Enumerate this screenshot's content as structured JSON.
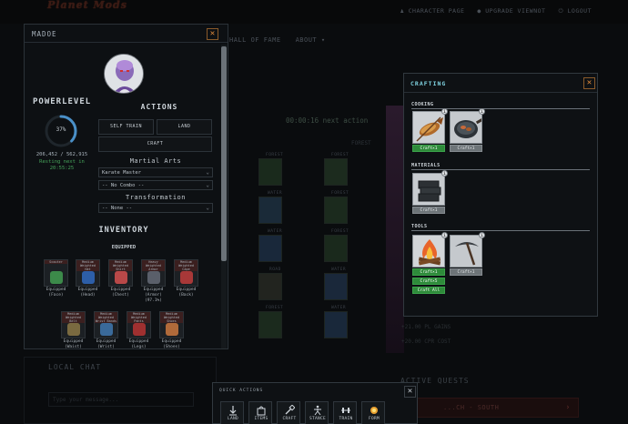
{
  "site": {
    "logo": "Planet Mods",
    "top_links": [
      "CHARACTER PAGE",
      "UPGRADE VIEWNOT",
      "LOGOUT"
    ],
    "nav": [
      "HALL OF FAME",
      "ABOUT"
    ],
    "timer_text": "00:00:16  next action",
    "biome_word": "FOREST",
    "tiles": [
      "FOREST",
      "FOREST",
      "WATER",
      "FOREST",
      "WATER",
      "FOREST",
      "ROAD",
      "WATER",
      "FOREST",
      "WATER"
    ],
    "bg_stats": [
      "+21.00 PL GAINS",
      "+20.00 CPR COST"
    ],
    "local_chat": {
      "title": "LOCAL CHAT",
      "placeholder": "Type your message..."
    },
    "quests": {
      "title": "ACTIVE QUESTS",
      "row": "...CH - SOUTH"
    }
  },
  "character": {
    "name": "MADOE",
    "powerlevel_label": "POWERLEVEL",
    "progress_percent": 37,
    "progress_text": "37%",
    "powerlevel_numbers": "206,452 / 562,915",
    "rest_status": "Resting next in\n20:55:25",
    "actions": {
      "title": "ACTIONS",
      "self_train": "SELF TRAIN",
      "land": "LAND",
      "craft": "CRAFT"
    },
    "martial_arts": {
      "title": "Martial Arts",
      "style": "Karate Master",
      "combo": "-- No Combo --"
    },
    "transformation": {
      "title": "Transformation",
      "value": "-- None --"
    },
    "inventory": {
      "title": "INVENTORY",
      "equipped_title": "EQUIPPED",
      "slots": [
        {
          "tag": "Scouter",
          "label": "Equipped\n(Face)",
          "color": "#3c8a4a"
        },
        {
          "tag": "Medium Weighted Hat",
          "label": "Equipped\n(Head)",
          "color": "#2d5ea8"
        },
        {
          "tag": "Medium Weighted Shirt",
          "label": "Equipped\n(Chest)",
          "color": "#b84848"
        },
        {
          "tag": "Heavy Weighted Armor",
          "label": "Equipped\n(Armor)\n(97.1%)",
          "color": "#5a5f6a"
        },
        {
          "tag": "Medium Weighted Cape",
          "label": "Equipped\n(Back)",
          "color": "#a83838"
        },
        {
          "tag": "Medium Weighted Belt",
          "label": "Equipped\n(Waist)",
          "color": "#7a6a40"
        },
        {
          "tag": "Medium Weighted Wrist Bands",
          "label": "Equipped\n(Wrist)",
          "color": "#3a6a9a"
        },
        {
          "tag": "Medium Weighted Pants",
          "label": "Equipped\n(Legs)",
          "color": "#a03030"
        },
        {
          "tag": "Medium Weighted Shoes",
          "label": "Equipped\n(Shoes)",
          "color": "#b06a3a"
        }
      ]
    }
  },
  "crafting": {
    "title": "CRAFTING",
    "categories": [
      {
        "name": "COOKING",
        "items": [
          {
            "icon": "grilled-fish-icon",
            "button": "Craft×1",
            "enabled": true
          },
          {
            "icon": "cooking-pan-icon",
            "button": "Craft×1",
            "enabled": false
          }
        ]
      },
      {
        "name": "MATERIALS",
        "items": [
          {
            "icon": "stone-blocks-icon",
            "button": "Craft×1",
            "enabled": false
          }
        ]
      },
      {
        "name": "TOOLS",
        "items": [
          {
            "icon": "campfire-icon",
            "button": "Craft×1",
            "enabled": true,
            "extra_buttons": [
              "Craft×5",
              "Craft All"
            ]
          },
          {
            "icon": "pickaxe-icon",
            "button": "Craft×1",
            "enabled": false
          }
        ]
      }
    ]
  },
  "quick_actions": {
    "title": "QUICK ACTIONS",
    "buttons": [
      {
        "label": "LAND",
        "icon": "land-icon"
      },
      {
        "label": "ITEMS",
        "icon": "items-icon"
      },
      {
        "label": "CRAFT",
        "icon": "craft-icon"
      },
      {
        "label": "STANCE",
        "icon": "stance-icon"
      },
      {
        "label": "TRAIN",
        "icon": "train-icon"
      },
      {
        "label": "FORM",
        "icon": "form-icon"
      }
    ]
  },
  "colors": {
    "accent_orange": "#e08a3a",
    "craft_title": "#7fd2e0",
    "craft_green": "#2e8b3a",
    "progress_ring": "#4a90c8"
  }
}
